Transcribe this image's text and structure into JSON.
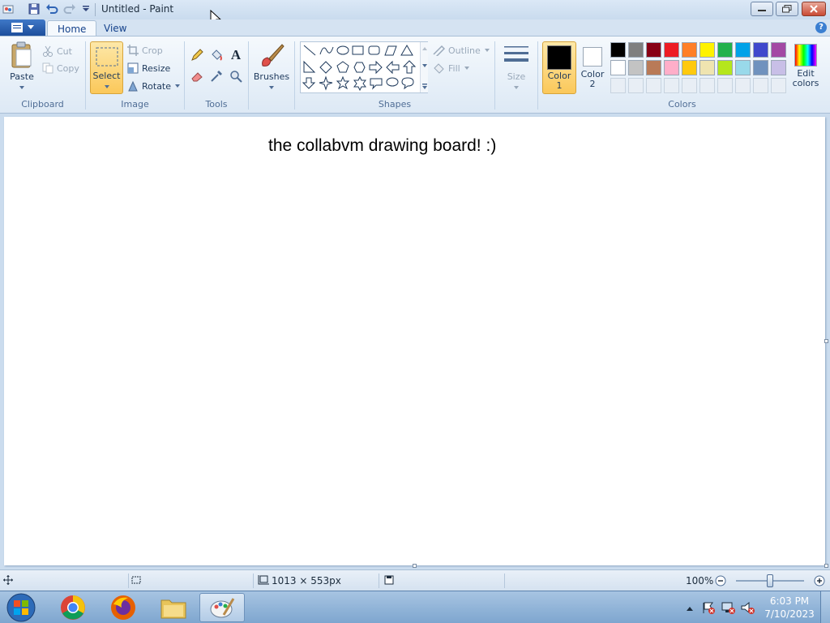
{
  "window": {
    "title": "Untitled - Paint"
  },
  "quick_access": {
    "icons": [
      "paint-app-icon",
      "save-icon",
      "undo-icon",
      "redo-icon",
      "customize-dropdown-icon"
    ]
  },
  "tabs": [
    {
      "label": "Home",
      "active": true
    },
    {
      "label": "View",
      "active": false
    }
  ],
  "ribbon": {
    "clipboard": {
      "paste": "Paste",
      "cut": "Cut",
      "copy": "Copy",
      "group": "Clipboard"
    },
    "image": {
      "select": "Select",
      "crop": "Crop",
      "resize": "Resize",
      "rotate": "Rotate",
      "group": "Image"
    },
    "tools": {
      "group": "Tools"
    },
    "brushes": {
      "label": "Brushes"
    },
    "shapes": {
      "outline": "Outline",
      "fill": "Fill",
      "group": "Shapes"
    },
    "size": {
      "label": "Size"
    },
    "colors": {
      "color1": "Color",
      "color1_num": "1",
      "color2": "Color",
      "color2_num": "2",
      "edit": "Edit",
      "edit2": "colors",
      "group": "Colors",
      "color1_value": "#000000",
      "color2_value": "#ffffff",
      "palette_row1": [
        "#000000",
        "#7f7f7f",
        "#880015",
        "#ed1c24",
        "#ff7f27",
        "#fff200",
        "#22b14c",
        "#00a2e8",
        "#3f48cc",
        "#a349a4"
      ],
      "palette_row2": [
        "#ffffff",
        "#c3c3c3",
        "#b97a57",
        "#ffaec9",
        "#ffc90e",
        "#efe4b0",
        "#b5e61d",
        "#99d9ea",
        "#7092be",
        "#c8bfe7"
      ]
    }
  },
  "canvas": {
    "text": "the collabvm drawing board! :)"
  },
  "status": {
    "dimensions": "1013 × 553px",
    "zoom": "100%",
    "zoom_level": 0.5
  },
  "taskbar": {
    "time": "6:03 PM",
    "date": "7/10/2023"
  }
}
